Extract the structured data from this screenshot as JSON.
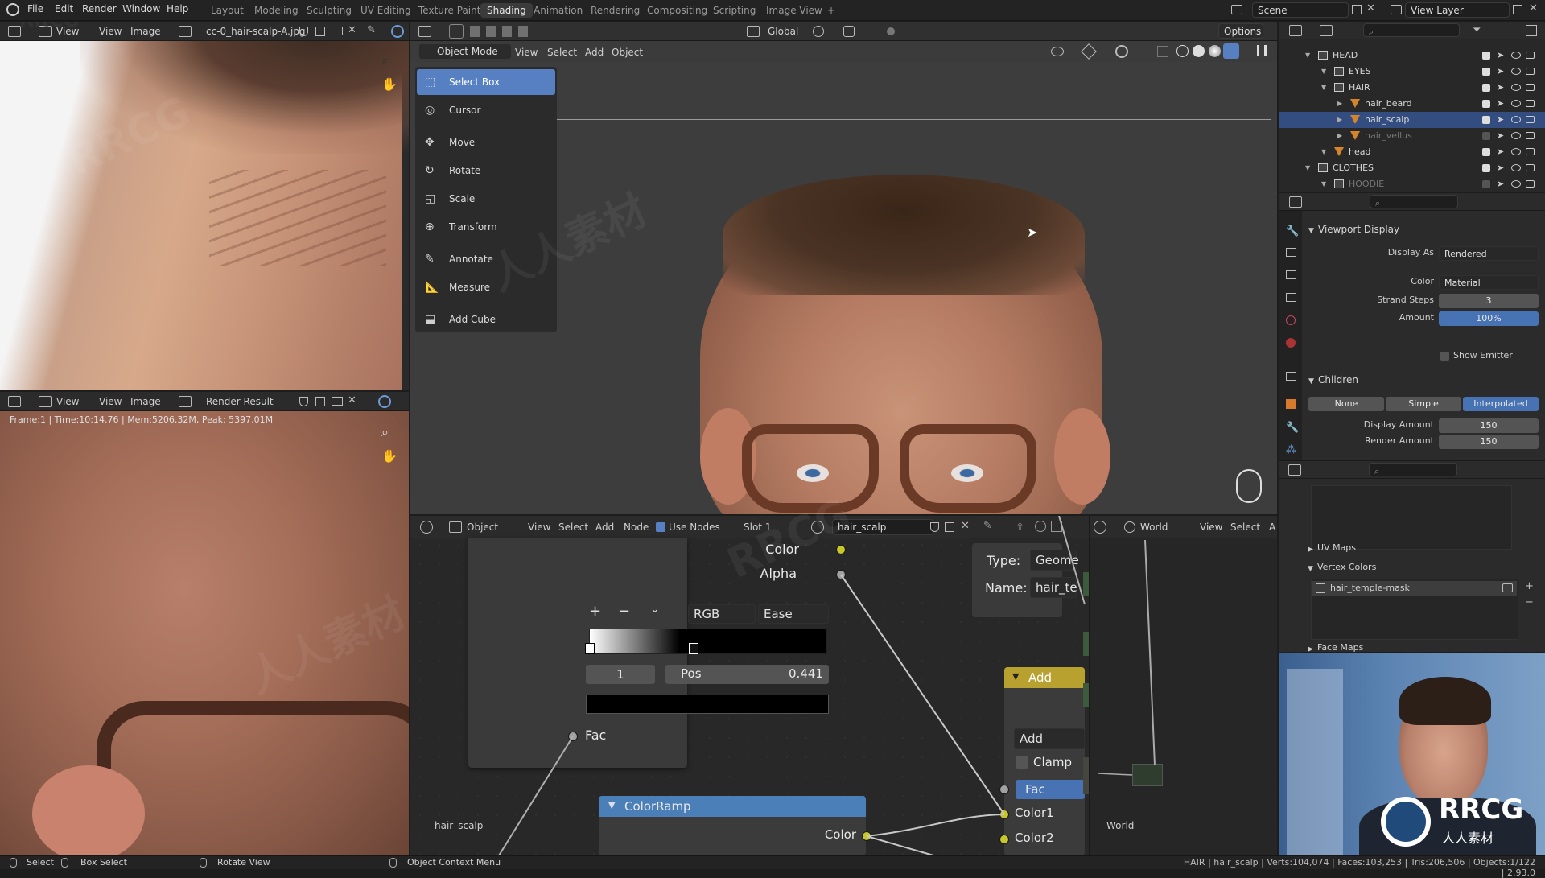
{
  "topbar": {
    "menus": [
      "File",
      "Edit",
      "Render",
      "Window",
      "Help"
    ],
    "workspaces": [
      "Layout",
      "Modeling",
      "Sculpting",
      "UV Editing",
      "Texture Paint",
      "Shading",
      "Animation",
      "Rendering",
      "Compositing",
      "Scripting",
      "Image View"
    ],
    "active_workspace": "Shading",
    "add_tab": "+",
    "scene": "Scene",
    "view_layer": "View Layer"
  },
  "image_editor_top": {
    "view": "View",
    "view2": "View",
    "image": "Image",
    "image_name": "cc-0_hair-scalp-A.jpg"
  },
  "image_editor_bottom": {
    "view": "View",
    "view2": "View",
    "image": "Image",
    "image_name": "Render Result",
    "status": "Frame:1 | Time:10:14.76 | Mem:5206.32M, Peak: 5397.01M"
  },
  "viewport": {
    "mode": "Object Mode",
    "menus": [
      "View",
      "Select",
      "Add",
      "Object"
    ],
    "transform": "Global",
    "options": "Options",
    "tools": [
      {
        "label": "Select Box",
        "icon": "select-box-icon",
        "active": true
      },
      {
        "label": "Cursor",
        "icon": "cursor-icon"
      },
      {
        "label": "Move",
        "icon": "move-icon"
      },
      {
        "label": "Rotate",
        "icon": "rotate-icon"
      },
      {
        "label": "Scale",
        "icon": "scale-icon"
      },
      {
        "label": "Transform",
        "icon": "transform-icon"
      },
      {
        "label": "Annotate",
        "icon": "annotate-icon"
      },
      {
        "label": "Measure",
        "icon": "measure-icon"
      },
      {
        "label": "Add Cube",
        "icon": "add-cube-icon"
      }
    ]
  },
  "node_editor": {
    "object": "Object",
    "menus": [
      "View",
      "Select",
      "Add",
      "Node"
    ],
    "use_nodes": "Use Nodes",
    "slot": "Slot 1",
    "material": "hair_scalp",
    "world": "World",
    "menus_right": [
      "View",
      "Select",
      "A"
    ],
    "colorramp_popup": {
      "color": "Color",
      "alpha": "Alpha",
      "plus": "+",
      "minus": "−",
      "color_mode": "RGB",
      "interpolation": "Ease",
      "index": "1",
      "pos_label": "Pos",
      "pos_value": "0.441",
      "fac": "Fac"
    },
    "attribute_popup": {
      "type_label": "Type:",
      "type_value": "Geome",
      "name_label": "Name:",
      "name_value": "hair_te"
    },
    "add_node": {
      "title": "Add",
      "blend": "Add",
      "clamp": "Clamp",
      "fac": "Fac",
      "color1": "Color1",
      "color2": "Color2"
    },
    "colorramp_node": {
      "title": "ColorRamp",
      "color": "Color"
    },
    "label_left": "hair_scalp",
    "label_right": "World"
  },
  "outliner": {
    "rows": [
      {
        "label": "HEAD",
        "indent": 0
      },
      {
        "label": "EYES",
        "indent": 1
      },
      {
        "label": "HAIR",
        "indent": 1
      },
      {
        "label": "hair_beard",
        "indent": 2
      },
      {
        "label": "hair_scalp",
        "indent": 2,
        "selected": true
      },
      {
        "label": "hair_vellus",
        "indent": 2,
        "dim": true
      },
      {
        "label": "head",
        "indent": 1
      },
      {
        "label": "CLOTHES",
        "indent": 0
      },
      {
        "label": "HOODIE",
        "indent": 1,
        "dim": true
      }
    ]
  },
  "properties": {
    "viewport_display": "Viewport Display",
    "display_as_label": "Display As",
    "display_as": "Rendered",
    "color_label": "Color",
    "color": "Material",
    "strand_steps_label": "Strand Steps",
    "strand_steps": "3",
    "amount_label": "Amount",
    "amount": "100%",
    "show_emitter": "Show Emitter",
    "children": "Children",
    "children_modes": [
      "None",
      "Simple",
      "Interpolated"
    ],
    "children_active": "Interpolated",
    "display_amount_label": "Display Amount",
    "display_amount": "150",
    "render_amount_label": "Render Amount",
    "render_amount": "150",
    "uv_maps": "UV Maps",
    "vertex_colors": "Vertex Colors",
    "vertex_color_item": "hair_temple-mask",
    "face_maps": "Face Maps"
  },
  "statusbar": {
    "select": "Select",
    "box_select": "Box Select",
    "rotate_view": "Rotate View",
    "context_menu": "Object Context Menu",
    "stats": "HAIR | hair_scalp | Verts:104,074 | Faces:103,253 | Tris:206,506 | Objects:1/122 | 2.93.0"
  },
  "watermark": {
    "logo_text": "RRCG",
    "logo_sub": "人人素材",
    "top_left": "RRCG"
  },
  "colors": {
    "accent": "#5680c2",
    "selected_row": "#334d80",
    "socket_yellow": "#c7c729",
    "colorramp_header": "#4a7fb8",
    "add_header": "#b8a12e"
  }
}
